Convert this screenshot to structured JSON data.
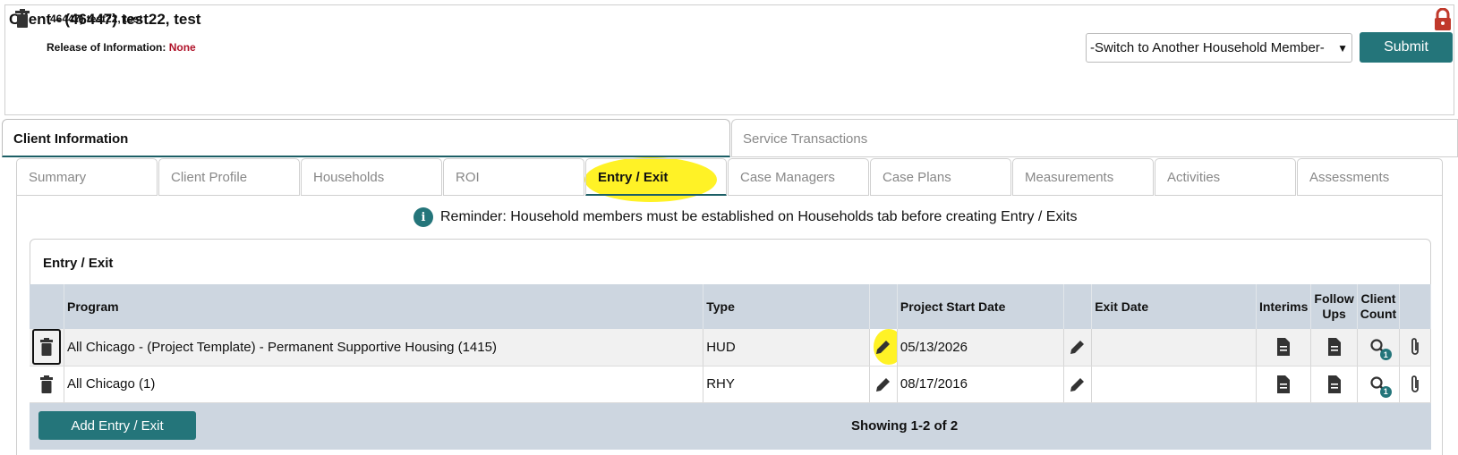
{
  "header": {
    "title": "Client - (46447) test22, test"
  },
  "client": {
    "name_line": "(46447) test22, test",
    "roi_label": "Release of Information:",
    "roi_value": "None"
  },
  "household_select": {
    "value": "-Switch to Another Household Member-"
  },
  "submit_label": "Submit",
  "main_tabs": [
    {
      "label": "Client Information",
      "active": true
    },
    {
      "label": "Service Transactions",
      "active": false
    }
  ],
  "sub_tabs": [
    {
      "label": "Summary"
    },
    {
      "label": "Client Profile"
    },
    {
      "label": "Households"
    },
    {
      "label": "ROI"
    },
    {
      "label": "Entry / Exit",
      "active": true
    },
    {
      "label": "Case Managers"
    },
    {
      "label": "Case Plans"
    },
    {
      "label": "Measurements"
    },
    {
      "label": "Activities"
    },
    {
      "label": "Assessments"
    }
  ],
  "reminder": "Reminder: Household members must be established on Households tab before creating Entry / Exits",
  "card_title": "Entry / Exit",
  "table": {
    "headers": {
      "program": "Program",
      "type": "Type",
      "start": "Project Start Date",
      "exit": "Exit Date",
      "interims": "Interims",
      "follow1": "Follow",
      "follow2": "Ups",
      "count1": "Client",
      "count2": "Count"
    },
    "rows": [
      {
        "program": "All Chicago - (Project Template) - Permanent Supportive Housing (1415)",
        "type": "HUD",
        "start": "05/13/2026",
        "exit": "",
        "count_badge": "1"
      },
      {
        "program": "All Chicago (1)",
        "type": "RHY",
        "start": "08/17/2016",
        "exit": "",
        "count_badge": "1"
      }
    ]
  },
  "add_label": "Add Entry / Exit",
  "showing": "Showing 1-2 of 2",
  "colors": {
    "accent": "#24757a",
    "highlight": "#fff000",
    "header_bg": "#cdd6e0"
  }
}
